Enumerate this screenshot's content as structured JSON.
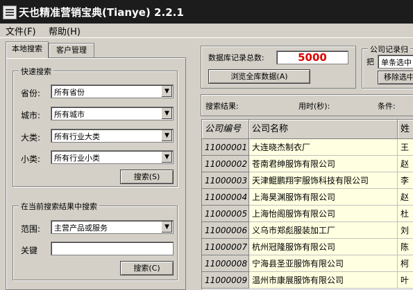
{
  "window": {
    "title": "天也精准营销宝典(Tianye) 2.2.1"
  },
  "menu": [
    {
      "label": "文件(F)"
    },
    {
      "label": "帮助(H)"
    }
  ],
  "tabs": [
    {
      "label": "本地搜索"
    },
    {
      "label": "客户管理"
    }
  ],
  "quick_search": {
    "legend": "快速搜索",
    "province": {
      "label": "省份:",
      "value": "所有省份"
    },
    "city": {
      "label": "城市:",
      "value": "所有城市"
    },
    "category": {
      "label": "大类:",
      "value": "所有行业大类"
    },
    "subcategory": {
      "label": "小类:",
      "value": "所有行业小类"
    },
    "search_button": "搜索(S)"
  },
  "refine_search": {
    "legend": "在当前搜索结果中搜索",
    "scope": {
      "label": "范围:",
      "value": "主营产品或服务"
    },
    "keyword": {
      "label": "关键",
      "value": ""
    },
    "search_button": "搜索(C)"
  },
  "stats": {
    "total_label": "数据库记录总数:",
    "total_value": "5000",
    "browse_button": "浏览全库数据(A)"
  },
  "archive": {
    "legend": "公司记录归",
    "prefix": "把",
    "select_value": "单条选中",
    "remove_button": "移除选中"
  },
  "results": {
    "label": "搜索结果:",
    "time_label": "用时(秒):",
    "condition_label": "条件:"
  },
  "table": {
    "columns": [
      "公司编号",
      "公司名称",
      "姓"
    ],
    "rows": [
      {
        "id": "11000001",
        "name": "大连晓杰制衣厂",
        "person": "王"
      },
      {
        "id": "11000002",
        "name": "苍南君绅服饰有限公司",
        "person": "赵"
      },
      {
        "id": "11000003",
        "name": "天津鲲鹏翔宇服饰科技有限公司",
        "person": "李"
      },
      {
        "id": "11000004",
        "name": "上海昊渊服饰有限公司",
        "person": "赵"
      },
      {
        "id": "11000005",
        "name": "上海怡阁服饰有限公司",
        "person": "杜"
      },
      {
        "id": "11000006",
        "name": "义乌市郑彪服装加工厂",
        "person": "刘"
      },
      {
        "id": "11000007",
        "name": "杭州冠隆服饰有限公司",
        "person": "陈"
      },
      {
        "id": "11000008",
        "name": "宁海县圣亚服饰有限公司",
        "person": "柯"
      },
      {
        "id": "11000009",
        "name": "温州市康展服饰有限公司",
        "person": "叶"
      }
    ]
  }
}
